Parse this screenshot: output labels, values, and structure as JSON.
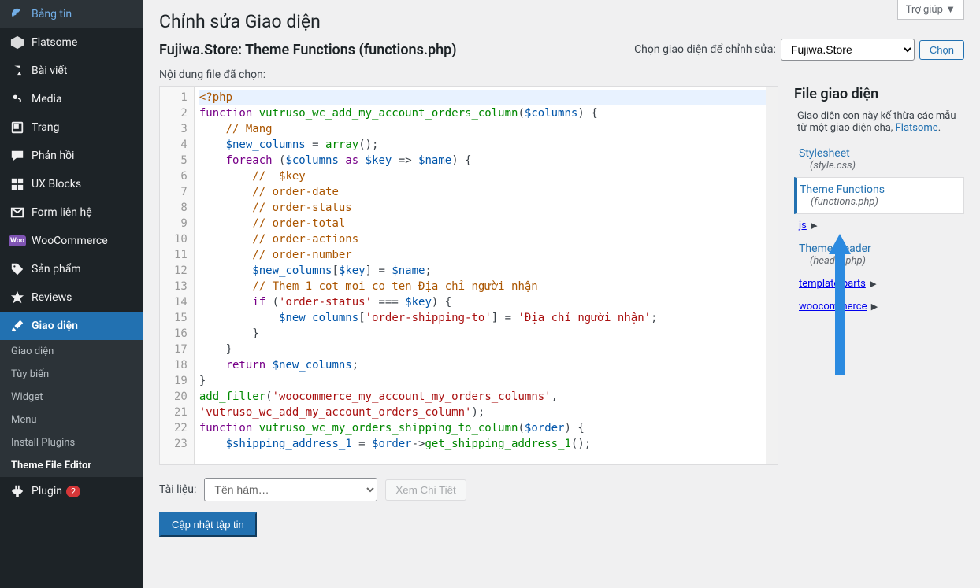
{
  "help_tab": "Trợ giúp ▼",
  "sidebar": {
    "items": [
      {
        "icon": "dashboard",
        "label": "Bảng tin"
      },
      {
        "icon": "flatsome",
        "label": "Flatsome"
      },
      {
        "icon": "pin",
        "label": "Bài viết"
      },
      {
        "icon": "media",
        "label": "Media"
      },
      {
        "icon": "page",
        "label": "Trang"
      },
      {
        "icon": "comment",
        "label": "Phản hồi"
      },
      {
        "icon": "blocks",
        "label": "UX Blocks"
      },
      {
        "icon": "mail",
        "label": "Form liên hệ"
      },
      {
        "icon": "woo",
        "label": "WooCommerce"
      },
      {
        "icon": "product",
        "label": "Sản phẩm"
      },
      {
        "icon": "star",
        "label": "Reviews"
      },
      {
        "icon": "brush",
        "label": "Giao diện",
        "current": true
      },
      {
        "icon": "plugin",
        "label": "Plugin",
        "badge": "2"
      }
    ],
    "submenu": [
      {
        "label": "Giao diện"
      },
      {
        "label": "Tùy biến"
      },
      {
        "label": "Widget"
      },
      {
        "label": "Menu"
      },
      {
        "label": "Install Plugins"
      },
      {
        "label": "Theme File Editor",
        "active": true
      }
    ]
  },
  "page": {
    "title": "Chỉnh sửa Giao diện",
    "file_title": "Fujiwa.Store: Theme Functions (functions.php)",
    "select_label": "Chọn giao diện để chỉnh sửa:",
    "theme_option": "Fujiwa.Store",
    "select_btn": "Chọn",
    "content_label": "Nội dung file đã chọn:"
  },
  "code": {
    "lines": [
      {
        "n": 1,
        "html": "<span class='cm'>&lt;?php</span>"
      },
      {
        "n": 2,
        "html": "<span class='kw'>function</span> <span class='fn'>vutruso_wc_add_my_account_orders_column</span>(<span class='var'>$columns</span>) {"
      },
      {
        "n": 3,
        "html": "    <span class='cm'>// Mang</span>"
      },
      {
        "n": 4,
        "html": "    <span class='var'>$new_columns</span> = <span class='fn'>array</span>();"
      },
      {
        "n": 5,
        "html": "    <span class='kw'>foreach</span> (<span class='var'>$columns</span> <span class='kw'>as</span> <span class='var'>$key</span> =&gt; <span class='var'>$name</span>) {"
      },
      {
        "n": 6,
        "html": "        <span class='cm'>//  $key</span>"
      },
      {
        "n": 7,
        "html": "        <span class='cm'>// order-date</span>"
      },
      {
        "n": 8,
        "html": "        <span class='cm'>// order-status</span>"
      },
      {
        "n": 9,
        "html": "        <span class='cm'>// order-total</span>"
      },
      {
        "n": 10,
        "html": "        <span class='cm'>// order-actions</span>"
      },
      {
        "n": 11,
        "html": "        <span class='cm'>// order-number</span>"
      },
      {
        "n": 12,
        "html": "        <span class='var'>$new_columns</span>[<span class='var'>$key</span>] = <span class='var'>$name</span>;"
      },
      {
        "n": 13,
        "html": "        <span class='cm'>// Them 1 cot moi co ten Địa chỉ người nhận</span>"
      },
      {
        "n": 14,
        "html": "        <span class='kw'>if</span> (<span class='str'>'order-status'</span> === <span class='var'>$key</span>) {"
      },
      {
        "n": 15,
        "html": "            <span class='var'>$new_columns</span>[<span class='str'>'order-shipping-to'</span>] = <span class='str'>'Địa chỉ người nhận'</span>;"
      },
      {
        "n": 16,
        "html": "        }"
      },
      {
        "n": 17,
        "html": "    }"
      },
      {
        "n": 18,
        "html": "    <span class='kw'>return</span> <span class='var'>$new_columns</span>;"
      },
      {
        "n": 19,
        "html": "}"
      },
      {
        "n": 20,
        "html": "<span class='fn'>add_filter</span>(<span class='str'>'woocommerce_my_account_my_orders_columns'</span>,"
      },
      {
        "n": 21,
        "html": "<span class='str'>'vutruso_wc_add_my_account_orders_column'</span>);"
      },
      {
        "n": 22,
        "html": "<span class='kw'>function</span> <span class='fn'>vutruso_wc_my_orders_shipping_to_column</span>(<span class='var'>$order</span>) {"
      },
      {
        "n": 23,
        "html": "    <span class='var'>$shipping_address_1</span> = <span class='var'>$order</span>-&gt;<span class='fn'>get_shipping_address_1</span>();"
      }
    ]
  },
  "files": {
    "heading": "File giao diện",
    "desc_pre": "Giao diện con này kế thừa các mẫu từ một giao diện cha, ",
    "desc_link": "Flatsome",
    "entries": [
      {
        "name": "Stylesheet",
        "sub": "(style.css)"
      },
      {
        "name": "Theme Functions",
        "sub": "(functions.php)",
        "selected": true
      },
      {
        "name": "js",
        "folder": true
      },
      {
        "name": "Theme Header",
        "sub": "(header.php)"
      },
      {
        "name": "template-parts",
        "folder": true
      },
      {
        "name": "woocommerce",
        "folder": true
      }
    ]
  },
  "doc": {
    "label": "Tài liệu:",
    "placeholder": "Tên hàm…",
    "view_btn": "Xem Chi Tiết"
  },
  "update_btn": "Cập nhật tập tin"
}
